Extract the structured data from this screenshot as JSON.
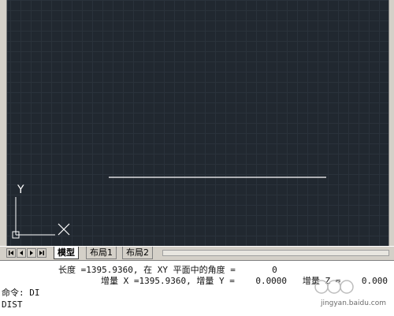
{
  "tabs": [
    {
      "label": "模型",
      "active": true
    },
    {
      "label": "布局1",
      "active": false
    },
    {
      "label": "布局2",
      "active": false
    }
  ],
  "ucs": {
    "y_label": "Y"
  },
  "command": {
    "line1": "长度 =1395.9360, 在 XY 平面中的角度 =       0",
    "line2": "增量 X =1395.9360, 增量 Y =    0.0000   增量 Z =    0.000",
    "prompt": "命令: DI",
    "input": "DIST"
  },
  "watermark": {
    "site": "jingyan.baidu.com"
  },
  "colors": {
    "canvas": "#212830",
    "grid": "#2a323b",
    "line": "#ffffff",
    "frame": "#d4d0c8"
  },
  "icons": [
    "first-tab-icon",
    "prev-tab-icon",
    "next-tab-icon",
    "last-tab-icon",
    "x-axis-marker-icon"
  ]
}
